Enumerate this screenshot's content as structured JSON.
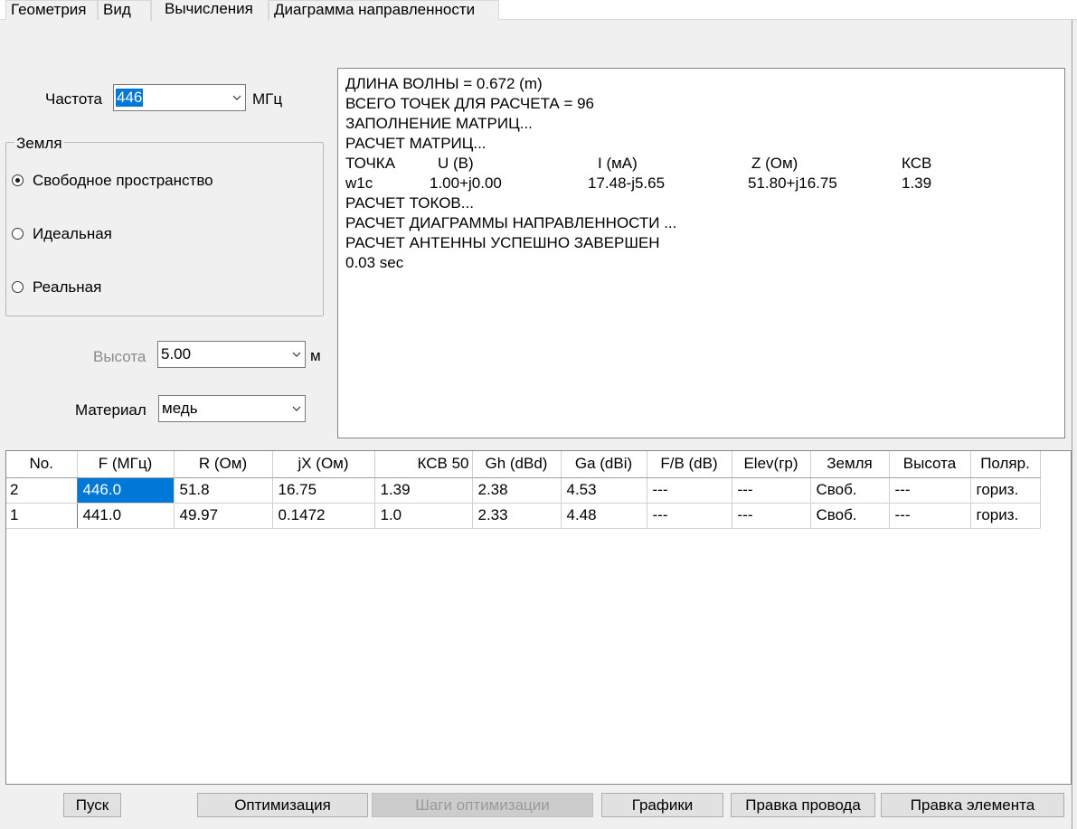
{
  "tabs": [
    "Геометрия",
    "Вид",
    "Вычисления",
    "Диаграмма направленности"
  ],
  "active_tab": "Вычисления",
  "frequency": {
    "label": "Частота",
    "value": "446",
    "unit": "МГц"
  },
  "ground": {
    "title": "Земля",
    "options": [
      "Свободное пространство",
      "Идеальная",
      "Реальная"
    ],
    "selected": "Свободное пространство"
  },
  "height": {
    "label": "Высота",
    "value": "5.00",
    "unit": "м"
  },
  "material": {
    "label": "Материал",
    "value": "медь"
  },
  "log": {
    "lines_top": [
      "ДЛИНА ВОЛНЫ = 0.672 (m)",
      "ВСЕГО ТОЧЕК ДЛЯ РАСЧЕТА = 96",
      "ЗАПОЛНЕНИЕ МАТРИЦ...",
      "РАСЧЕТ МАТРИЦ..."
    ],
    "table_header": [
      "ТОЧКА",
      "U (В)",
      "I (мА)",
      "Z (Ом)",
      "КСВ"
    ],
    "table_row": [
      "w1c",
      "1.00+j0.00",
      "17.48-j5.65",
      "51.80+j16.75",
      "1.39"
    ],
    "lines_bottom": [
      "РАСЧЕТ ТОКОВ...",
      "РАСЧЕТ ДИАГРАММЫ НАПРАВЛЕННОСТИ ...",
      "РАСЧЕТ АНТЕННЫ УСПЕШНО ЗАВЕРШЕН",
      "0.03 sec"
    ]
  },
  "results": {
    "columns": [
      "No.",
      "F (МГц)",
      "R (Ом)",
      "jX (Ом)",
      "КСВ 50",
      "Gh (dBd)",
      "Ga (dBi)",
      "F/B (dB)",
      "Elev(гр)",
      "Земля",
      "Высота",
      "Поляр."
    ],
    "rows": [
      [
        "2",
        "446.0",
        "51.8",
        "16.75",
        "1.39",
        "2.38",
        "4.53",
        "---",
        "---",
        "Своб.",
        "---",
        "гориз."
      ],
      [
        "1",
        "441.0",
        "49.97",
        "0.1472",
        "1.0",
        "2.33",
        "4.48",
        "---",
        "---",
        "Своб.",
        "---",
        "гориз."
      ]
    ]
  },
  "buttons": {
    "start": "Пуск",
    "optimize": "Оптимизация",
    "opt_steps": "Шаги оптимизации",
    "graphs": "Графики",
    "edit_wire": "Правка провода",
    "edit_element": "Правка элемента"
  },
  "colors": {
    "selection": "#0078d7",
    "window_bg": "#f0f0f0"
  }
}
